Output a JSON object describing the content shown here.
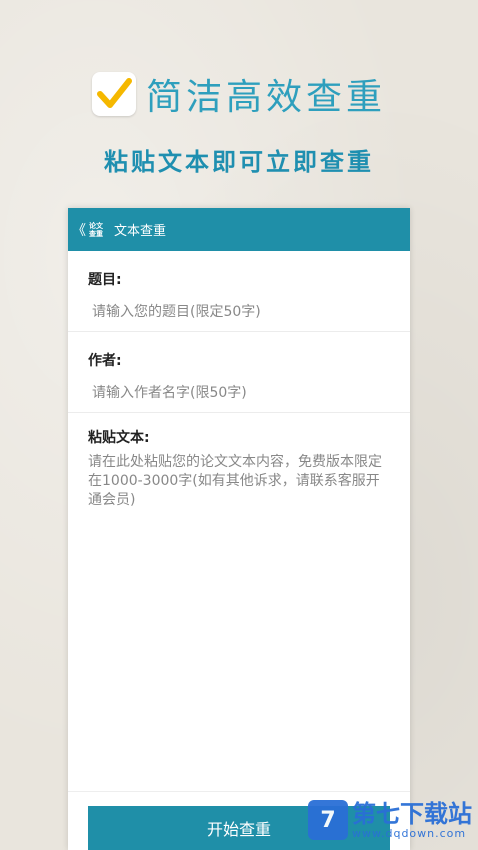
{
  "promo": {
    "headline": "简洁高效查重",
    "subheadline": "粘贴文本即可立即查重"
  },
  "appbar": {
    "back_glyph": "《",
    "logo_line1": "论文",
    "logo_line2": "查重",
    "title": "文本查重"
  },
  "form": {
    "title_label": "题目:",
    "title_placeholder": "请输入您的题目(限定50字)",
    "author_label": "作者:",
    "author_placeholder": "请输入作者名字(限50字)",
    "content_label": "粘贴文本:",
    "content_placeholder": "请在此处粘贴您的论文文本内容，免费版本限定在1000-3000字(如有其他诉求，请联系客服开通会员)"
  },
  "actions": {
    "start_label": "开始查重"
  },
  "watermark": {
    "logo_glyph": "7",
    "title": "第七下载站",
    "site": "www.dqdown.com"
  },
  "colors": {
    "accent": "#1f8fa8",
    "headline": "#2e9fbd",
    "check": "#f5b800"
  }
}
